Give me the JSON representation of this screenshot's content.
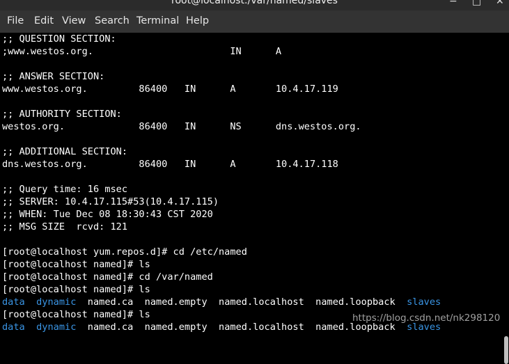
{
  "window": {
    "title": "root@localhost:/var/named/slaves",
    "minimize_glyph": "−",
    "maximize_glyph": "□",
    "close_glyph": "✕"
  },
  "menu": [
    "File",
    "Edit",
    "View",
    "Search",
    "Terminal",
    "Help"
  ],
  "terminal": {
    "lines": [
      ";; QUESTION SECTION:",
      ";www.westos.org.                        IN      A",
      "",
      ";; ANSWER SECTION:",
      "www.westos.org.         86400   IN      A       10.4.17.119",
      "",
      ";; AUTHORITY SECTION:",
      "westos.org.             86400   IN      NS      dns.westos.org.",
      "",
      ";; ADDITIONAL SECTION:",
      "dns.westos.org.         86400   IN      A       10.4.17.118",
      "",
      ";; Query time: 16 msec",
      ";; SERVER: 10.4.17.115#53(10.4.17.115)",
      ";; WHEN: Tue Dec 08 18:30:43 CST 2020",
      ";; MSG SIZE  rcvd: 121",
      "",
      "[root@localhost yum.repos.d]# cd /etc/named",
      "[root@localhost named]# ls",
      "[root@localhost named]# cd /var/named",
      "[root@localhost named]# ls"
    ],
    "ls_output_1": {
      "dir1": "data",
      "dir2": "dynamic",
      "files": "named.ca  named.empty  named.localhost  named.loopback",
      "dir3": "slaves"
    },
    "prompt_after": "[root@localhost named]# ls",
    "ls_output_2": {
      "dir1": "data",
      "dir2": "dynamic",
      "files": "named.ca  named.empty  named.localhost  named.loopback",
      "dir3": "slaves"
    }
  },
  "watermark": "https://blog.csdn.net/nk298120",
  "colors": {
    "directory": "#3a95e5",
    "text": "#ffffff",
    "background": "#000000"
  }
}
